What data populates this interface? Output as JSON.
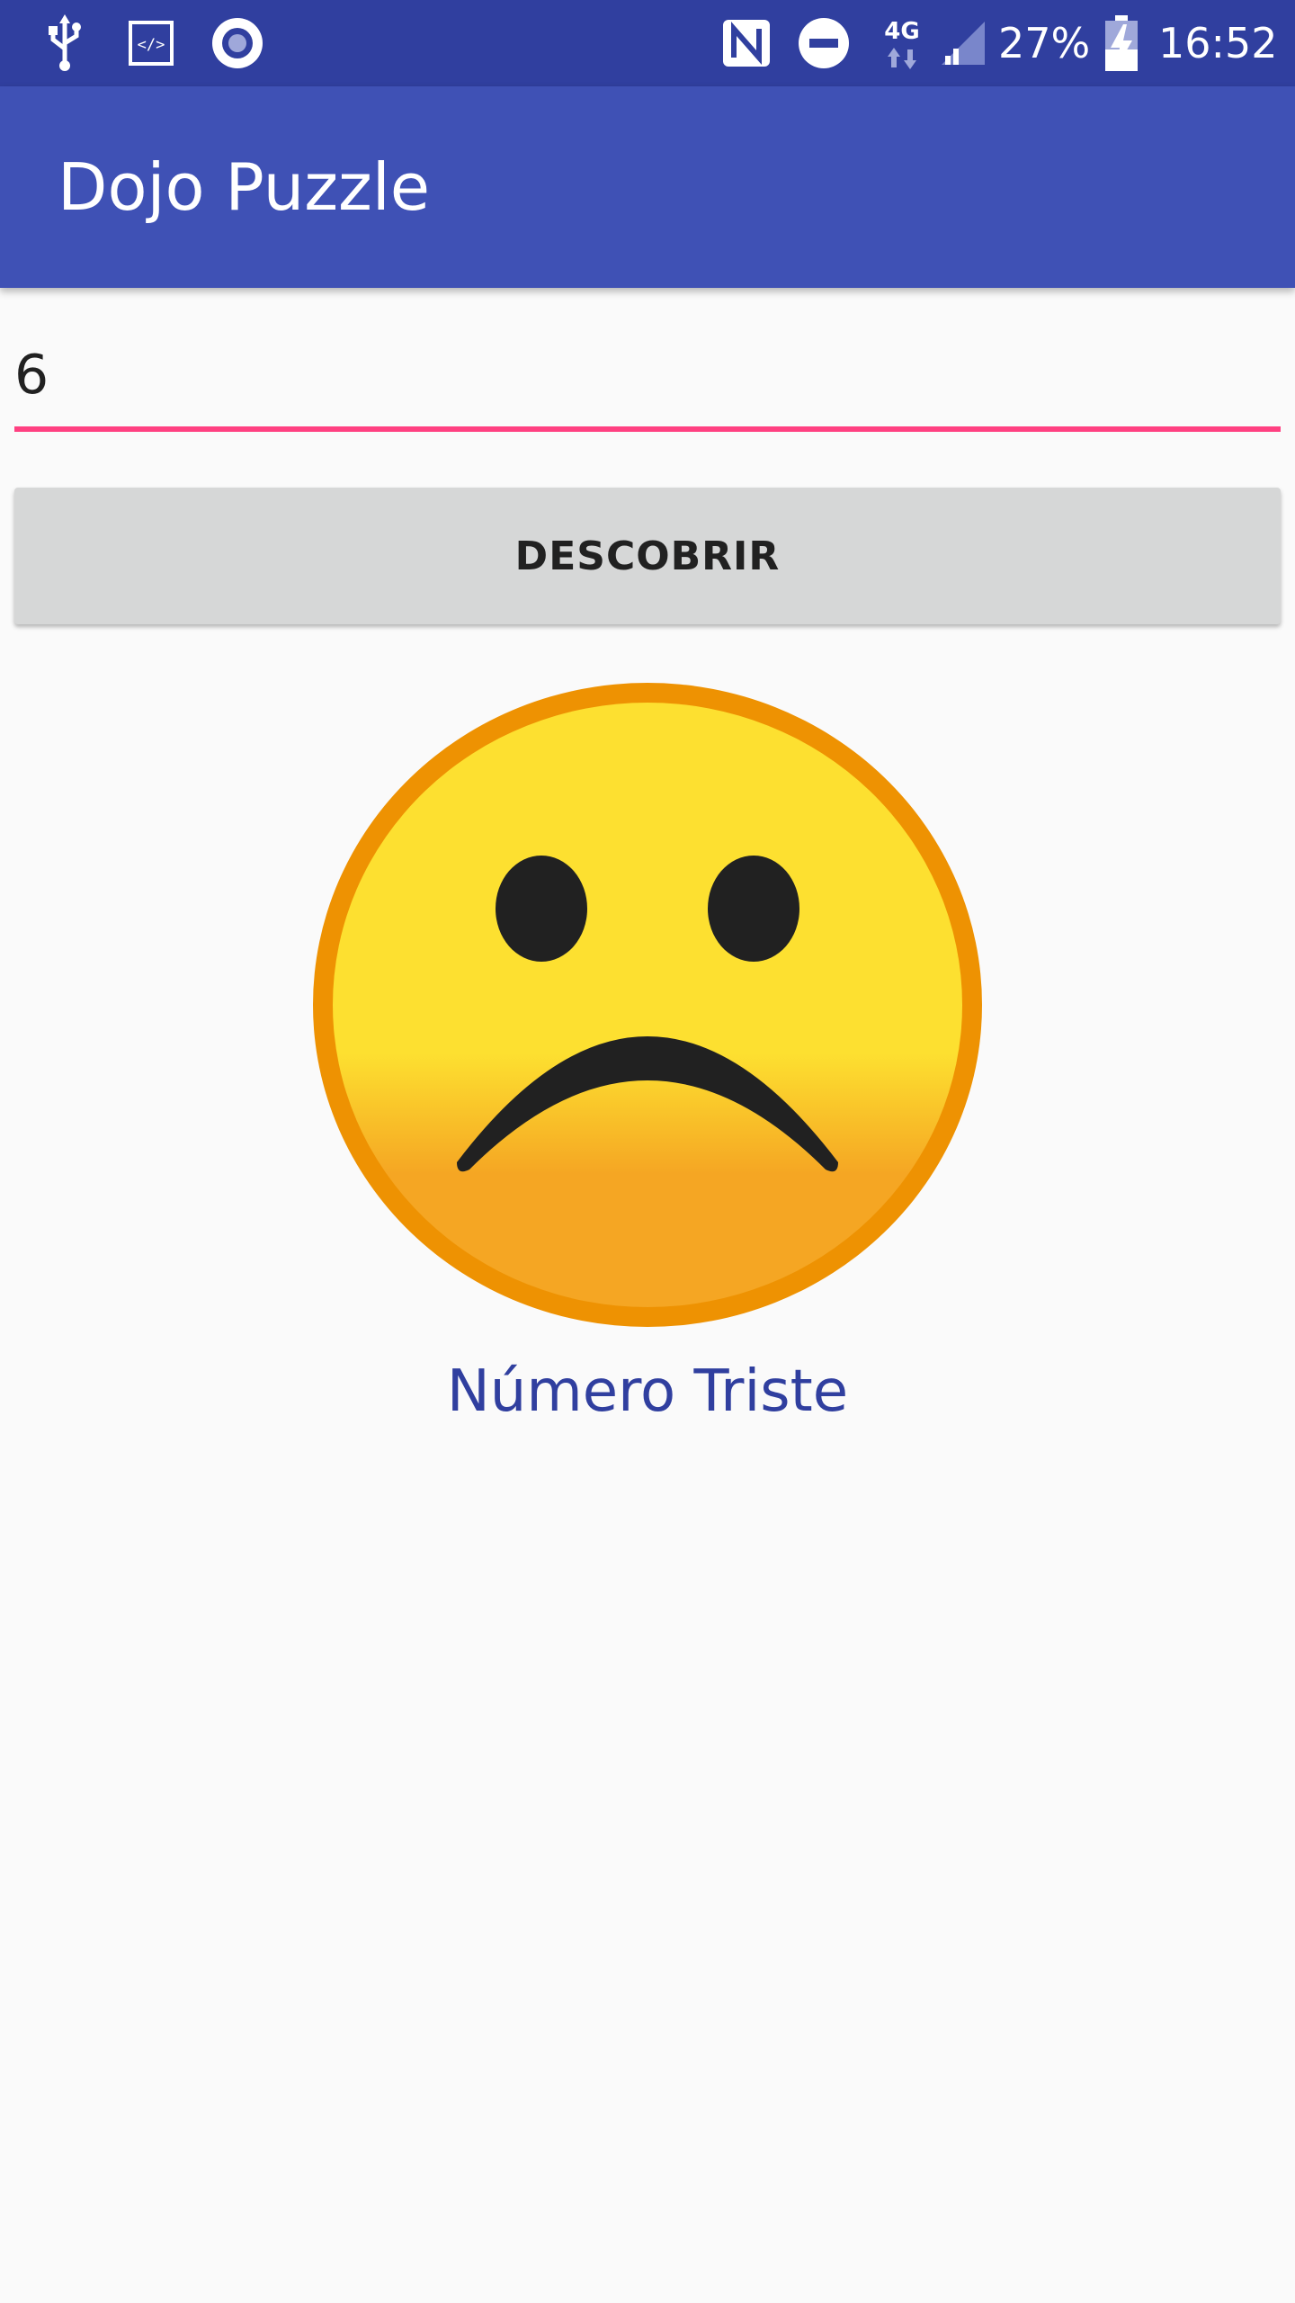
{
  "status_bar": {
    "icons_left": [
      "usb-icon",
      "developer-mode-icon",
      "record-icon"
    ],
    "icons_right": [
      "nfc-icon",
      "do-not-disturb-icon",
      "4g-data-icon",
      "cell-signal-icon",
      "battery-charging-icon"
    ],
    "network": "4G",
    "battery": "27%",
    "time": "16:52"
  },
  "app_bar": {
    "title": "Dojo Puzzle"
  },
  "form": {
    "input_value": "6",
    "button_label": "DESCOBRIR"
  },
  "result": {
    "icon": "sad-face-emoji",
    "label": "Número Triste"
  },
  "colors": {
    "status_bar": "#303f9f",
    "app_bar": "#3f51b5",
    "accent": "#ff4081",
    "button": "#d6d7d7",
    "result_text": "#303f9f",
    "background": "#fafafa"
  }
}
